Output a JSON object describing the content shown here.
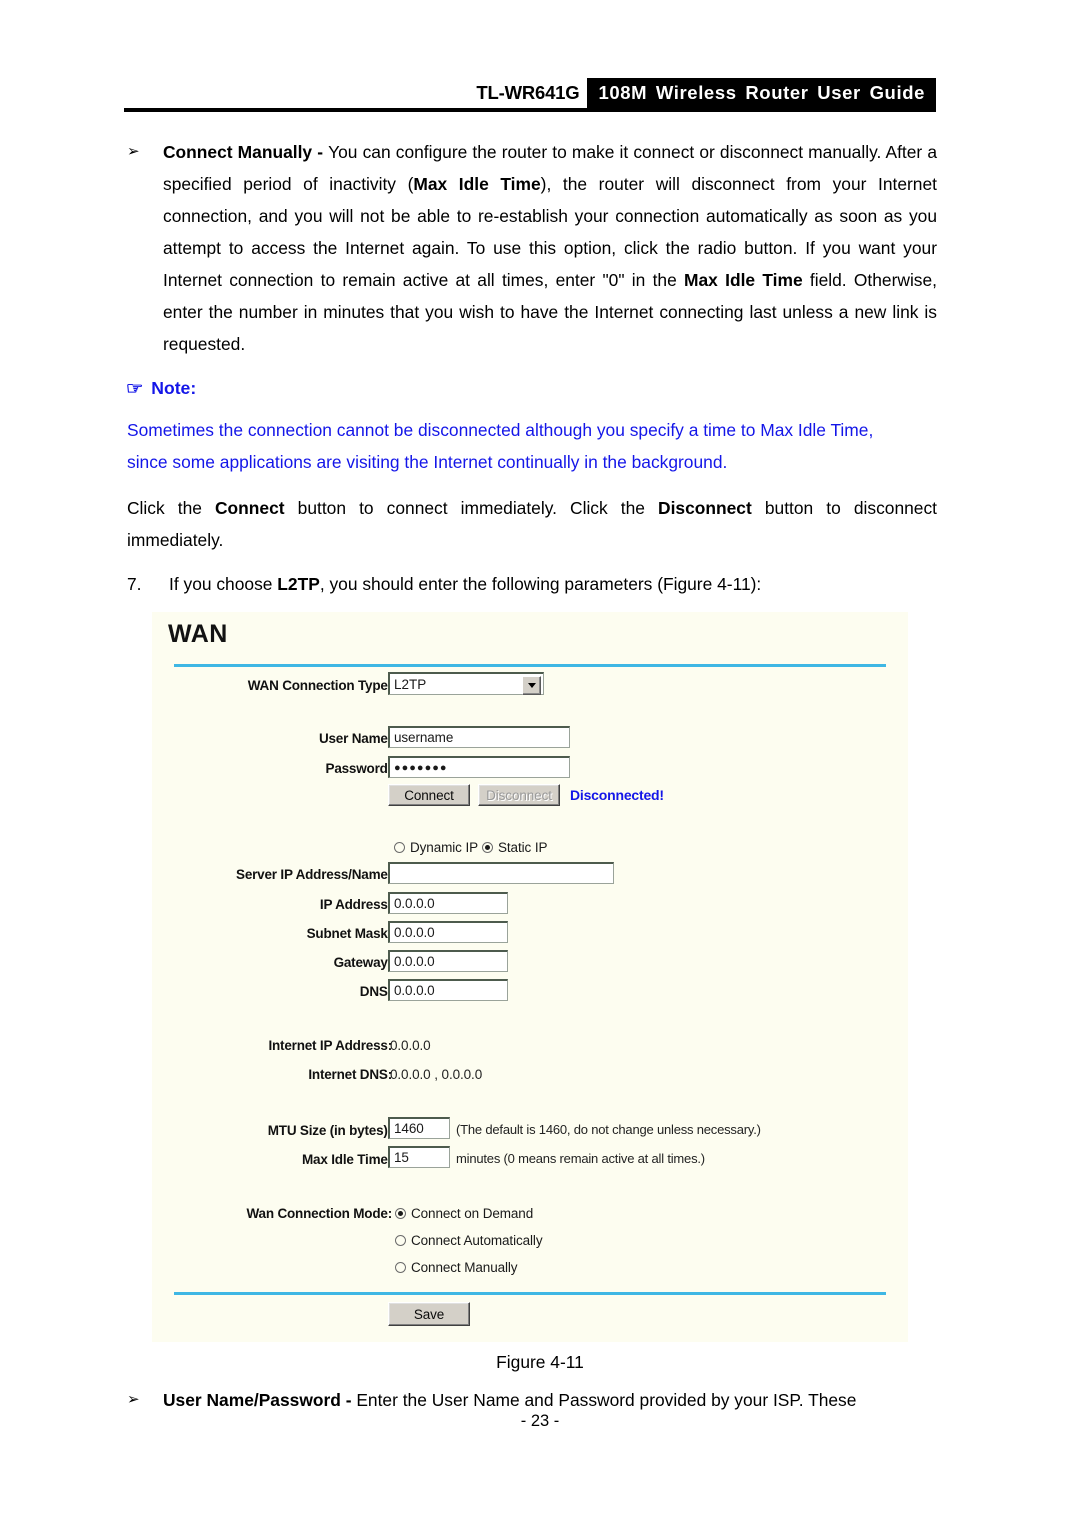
{
  "header": {
    "model": "TL-WR641G",
    "band_title": "108M Wireless Router User Guide"
  },
  "content": {
    "bullet_marker": "➢",
    "connect_manually": {
      "term": "Connect Manually",
      "dash": " - ",
      "text_1": "You can configure the router to make it connect or disconnect manually. After a specified period of inactivity (",
      "bold_1": "Max Idle Time",
      "text_2": "), the router will disconnect from your Internet connection, and you will not be able to re-establish your connection automatically as soon as you attempt to access the Internet again. To use this option, click the radio button. If you want your Internet connection to remain active at all times, enter \"0\" in the ",
      "bold_2": "Max Idle Time",
      "text_3": " field. Otherwise, enter the number in minutes that you wish to have the Internet connecting last unless a new link is requested."
    },
    "note": {
      "hand_icon": "☞",
      "label": "Note:",
      "line_1": "Sometimes the connection cannot be disconnected although you specify a time to Max Idle Time,",
      "line_2": "since some applications are visiting the Internet continually in the background."
    },
    "connect_para": {
      "t1": "Click the ",
      "b1": "Connect",
      "t2": " button to connect immediately. Click the ",
      "b2": "Disconnect",
      "t3": " button to disconnect immediately."
    },
    "step7": {
      "number": "7.",
      "t1": "If you choose ",
      "b1": "L2TP",
      "t2": ", you should enter the following parameters (Figure 4-11):"
    },
    "last_bullet": {
      "term": "User Name/Password",
      "dash": " - ",
      "text": "Enter the User Name and Password provided by your ISP. These"
    },
    "figure_caption": "Figure 4-11",
    "page_number": "- 23 -"
  },
  "wan_panel": {
    "title": "WAN",
    "fields": {
      "connection_type_label": "WAN Connection Type:",
      "connection_type_value": "L2TP",
      "user_name_label": "User Name:",
      "user_name_value": "username",
      "password_label": "Password:",
      "password_value": "●●●●●●●",
      "server_ip_label": "Server IP Address/Name:",
      "server_ip_value": "",
      "ip_address_label": "IP Address:",
      "ip_address_value": "0.0.0.0",
      "subnet_mask_label": "Subnet Mask:",
      "subnet_mask_value": "0.0.0.0",
      "gateway_label": "Gateway:",
      "gateway_value": "0.0.0.0",
      "dns_label": "DNS:",
      "dns_value": "0.0.0.0",
      "internet_ip_label": "Internet IP Address:",
      "internet_ip_value": "0.0.0.0",
      "internet_dns_label": "Internet DNS:",
      "internet_dns_value": "0.0.0.0 , 0.0.0.0",
      "mtu_label": "MTU Size (in bytes):",
      "mtu_value": "1460",
      "mtu_hint": "(The default is 1460, do not change unless necessary.)",
      "max_idle_label": "Max Idle Time:",
      "max_idle_value": "15",
      "max_idle_hint": "minutes (0 means remain active at all times.)",
      "wan_mode_label": "Wan Connection Mode:"
    },
    "buttons": {
      "connect": "Connect",
      "disconnect": "Disconnect",
      "save": "Save"
    },
    "status": "Disconnected!",
    "ip_mode_options": [
      {
        "label": "Dynamic IP",
        "checked": false
      },
      {
        "label": "Static IP",
        "checked": true
      }
    ],
    "wan_mode_options": [
      {
        "label": "Connect on Demand",
        "checked": true
      },
      {
        "label": "Connect Automatically",
        "checked": false
      },
      {
        "label": "Connect Manually",
        "checked": false
      }
    ]
  },
  "colors": {
    "note_blue": "#1416e8",
    "rule_blue": "#3fb7e4",
    "panel_bg": "#fdfdf0",
    "header_band": "#000000"
  }
}
